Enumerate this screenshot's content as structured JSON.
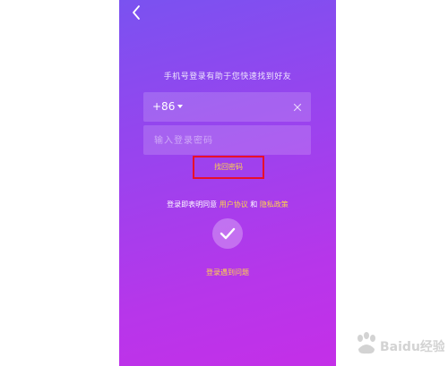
{
  "header": {
    "back_icon": "chevron-left-icon"
  },
  "login": {
    "subtitle": "手机号登录有助于您快速找到好友",
    "country_code": "+86",
    "phone_value": "",
    "clear_icon": "close-icon",
    "password_placeholder": "输入登录密码",
    "forgot_password": "找回密码"
  },
  "agreement": {
    "prefix": "登录即表明同意",
    "user_agreement": "用户协议",
    "connector": "和",
    "privacy_policy": "隐私政策"
  },
  "confirm": {
    "icon": "checkmark-icon"
  },
  "footer": {
    "problem_link": "登录遇到问题"
  },
  "watermark": {
    "text": "Baidu经验"
  },
  "colors": {
    "gradient_top": "#7a52f0",
    "gradient_bottom": "#c42fe8",
    "link": "#ffd54a",
    "highlight": "#e8102a"
  }
}
